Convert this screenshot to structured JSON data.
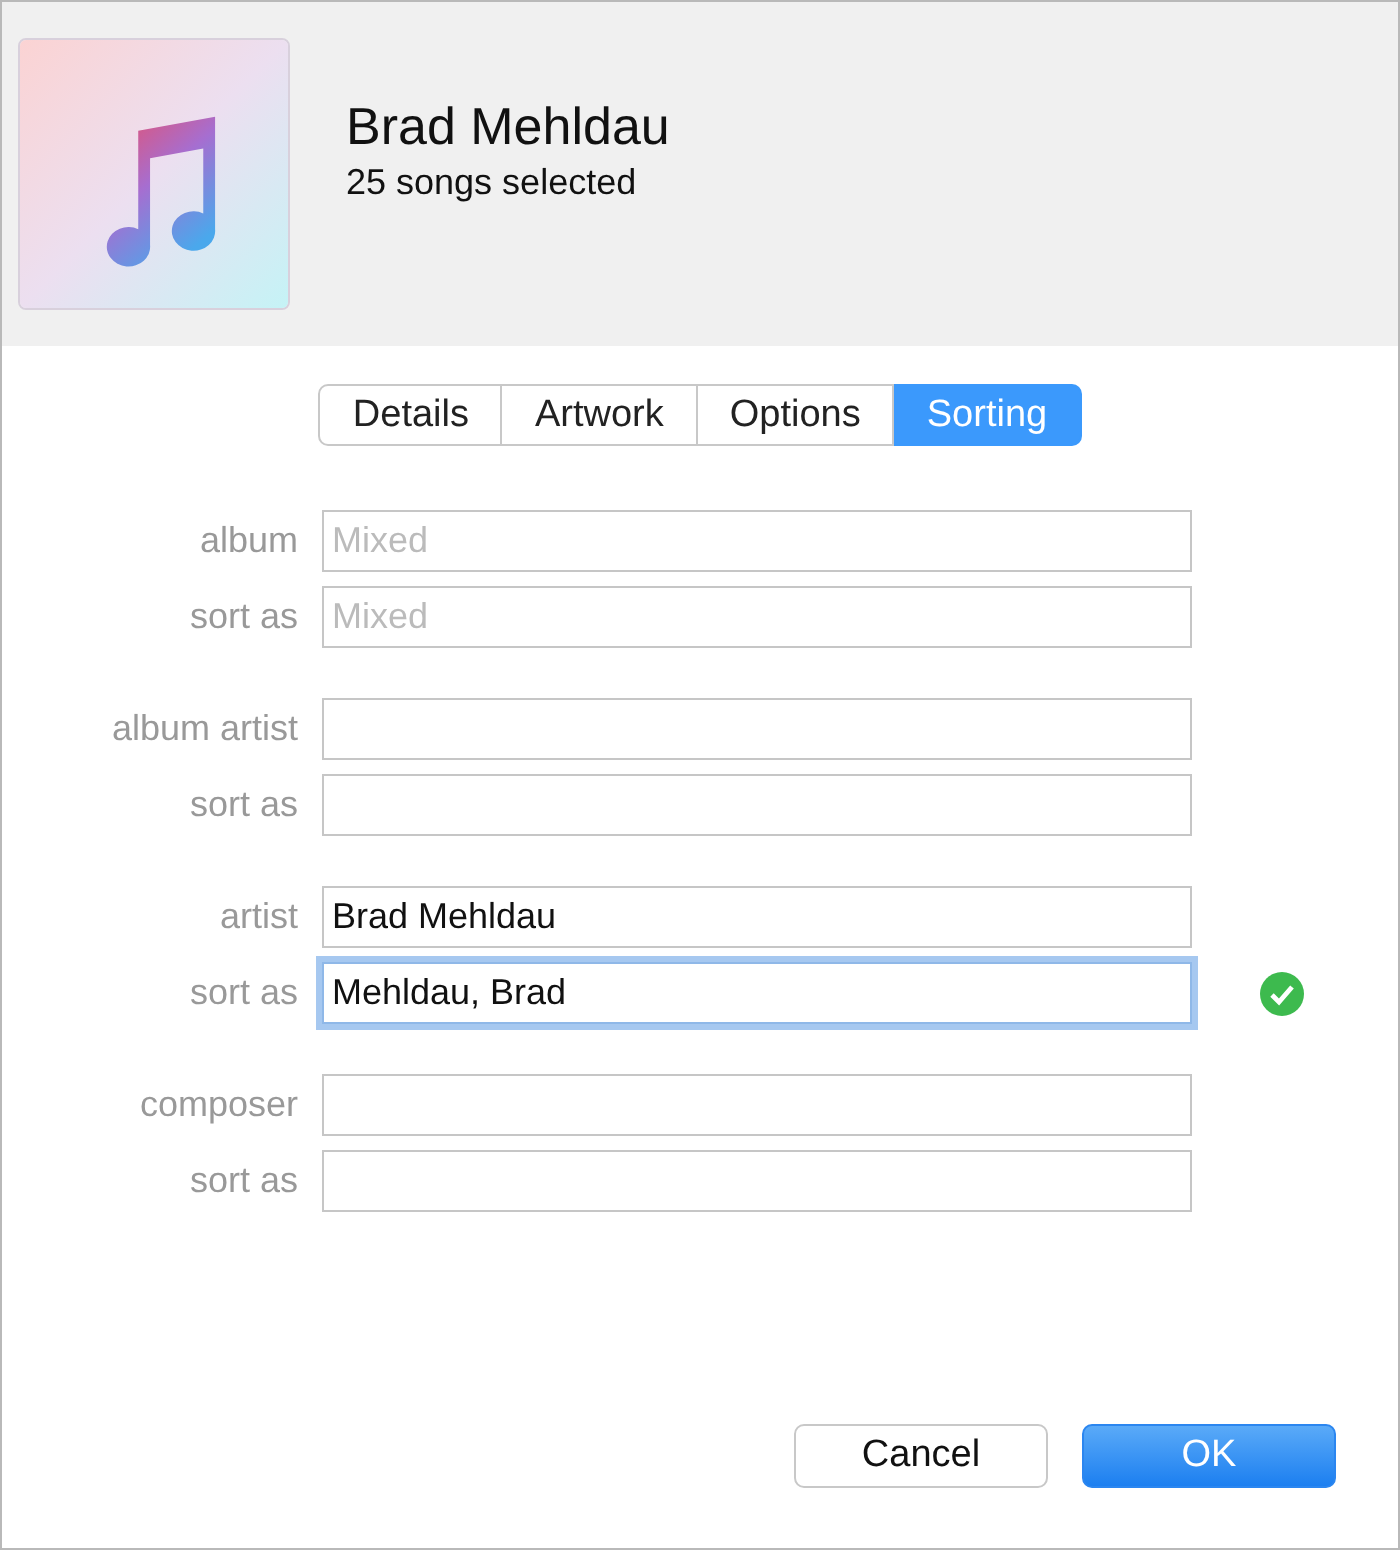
{
  "header": {
    "title": "Brad Mehldau",
    "subtitle": "25 songs selected"
  },
  "tabs": [
    {
      "label": "Details",
      "selected": false
    },
    {
      "label": "Artwork",
      "selected": false
    },
    {
      "label": "Options",
      "selected": false
    },
    {
      "label": "Sorting",
      "selected": true
    }
  ],
  "field_groups": [
    {
      "rows": [
        {
          "label": "album",
          "placeholder": "Mixed",
          "focused": false,
          "valid": false
        },
        {
          "label": "sort as",
          "placeholder": "Mixed",
          "focused": false,
          "valid": false
        }
      ]
    },
    {
      "rows": [
        {
          "label": "album artist",
          "focused": false,
          "valid": false
        },
        {
          "label": "sort as",
          "focused": false,
          "valid": false
        }
      ]
    },
    {
      "rows": [
        {
          "label": "artist",
          "value": "Brad Mehldau",
          "focused": false,
          "valid": false
        },
        {
          "label": "sort as",
          "value": "Mehldau, Brad",
          "focused": true,
          "valid": true
        }
      ]
    },
    {
      "rows": [
        {
          "label": "composer",
          "focused": false,
          "valid": false
        },
        {
          "label": "sort as",
          "focused": false,
          "valid": false
        }
      ]
    }
  ],
  "buttons": [
    {
      "label": "Cancel",
      "kind": "secondary"
    },
    {
      "label": "OK",
      "kind": "primary"
    }
  ]
}
